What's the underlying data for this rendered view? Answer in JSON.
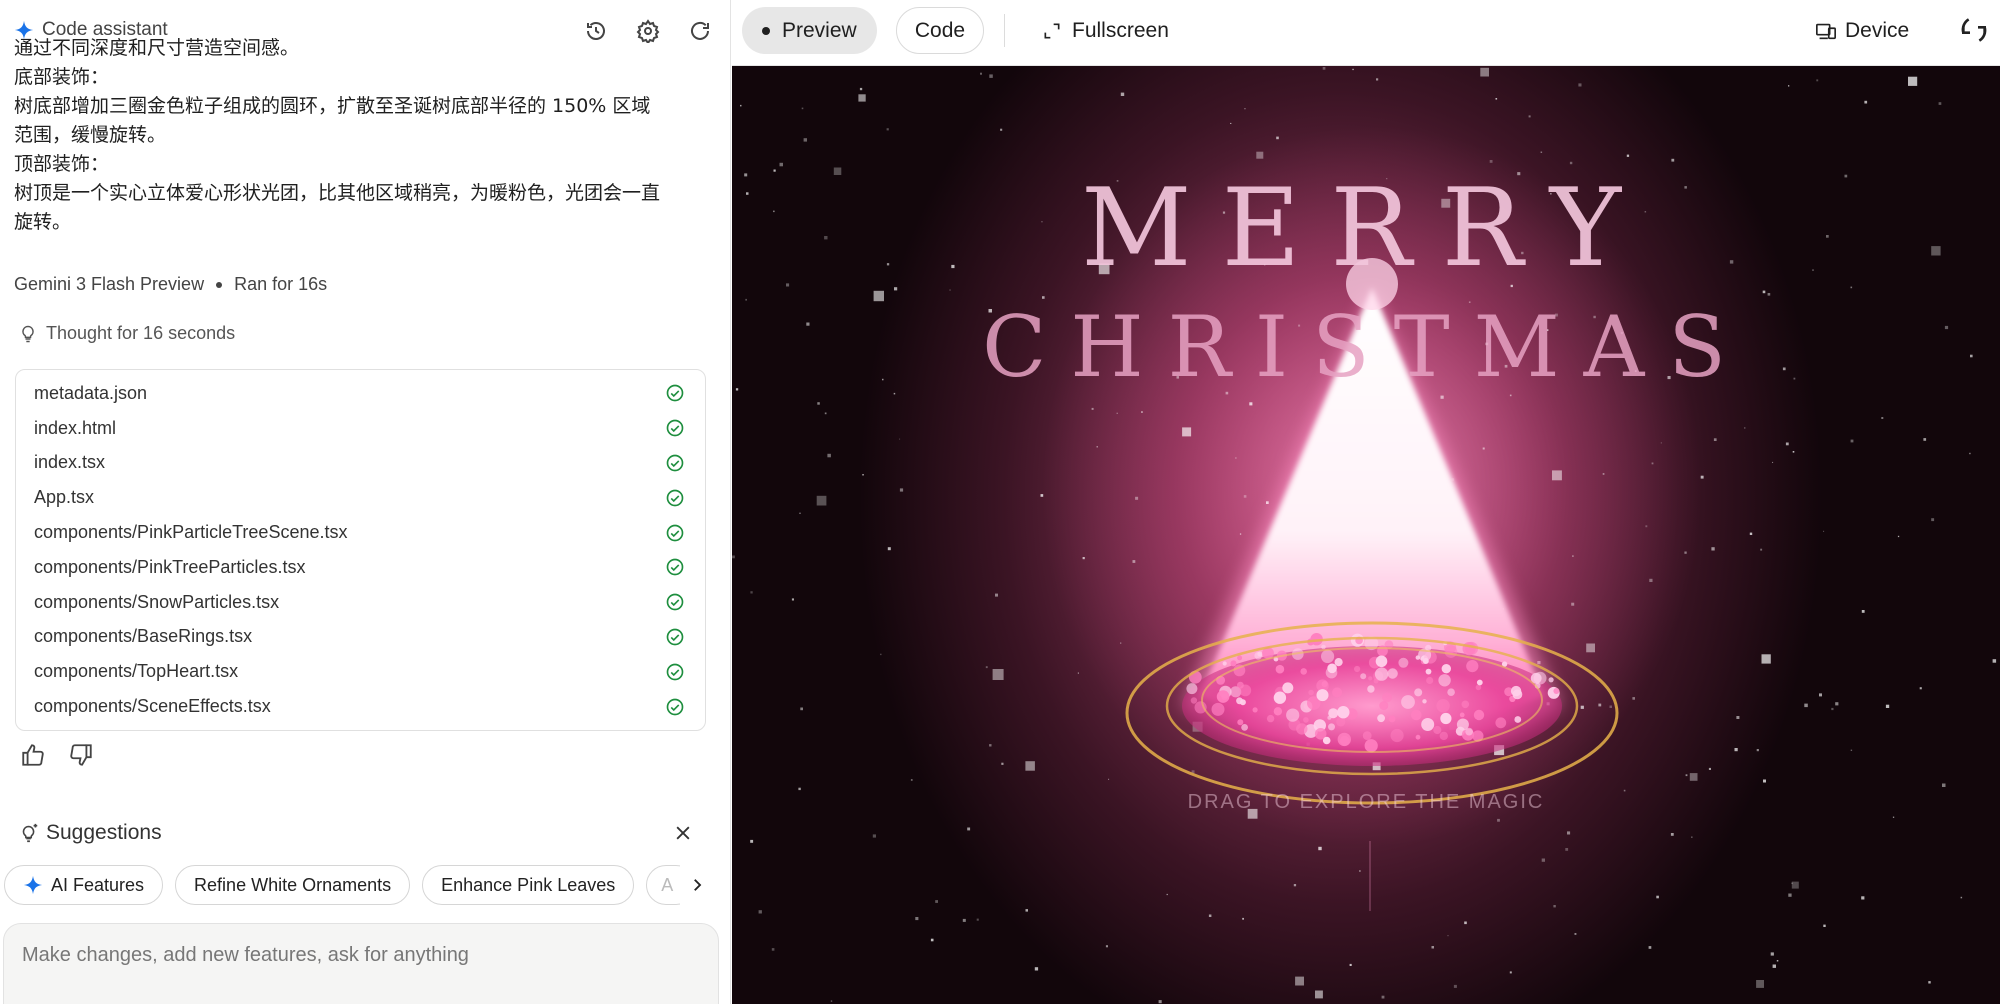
{
  "header": {
    "app_title": "Code assistant",
    "icons": [
      "history-icon",
      "gear-icon",
      "refresh-icon"
    ]
  },
  "chat": {
    "lines": [
      "通过不同深度和尺寸营造空间感。",
      "底部装饰：",
      "树底部增加三圈金色粒子组成的圆环，扩散至圣诞树底部半径的 150% 区域",
      "范围，缓慢旋转。",
      "顶部装饰：",
      "树顶是一个实心立体爱心形状光团，比其他区域稍亮，为暖粉色，光团会一直",
      "旋转。"
    ],
    "model": "Gemini 3 Flash Preview",
    "run_time": "Ran for 16s",
    "thought": "Thought for 16 seconds"
  },
  "files": [
    {
      "name": "metadata.json"
    },
    {
      "name": "index.html"
    },
    {
      "name": "index.tsx"
    },
    {
      "name": "App.tsx"
    },
    {
      "name": "components/PinkParticleTreeScene.tsx"
    },
    {
      "name": "components/PinkTreeParticles.tsx"
    },
    {
      "name": "components/SnowParticles.tsx"
    },
    {
      "name": "components/BaseRings.tsx"
    },
    {
      "name": "components/TopHeart.tsx"
    },
    {
      "name": "components/SceneEffects.tsx"
    }
  ],
  "suggestions": {
    "title": "Suggestions",
    "chips": [
      "AI Features",
      "Refine White Ornaments",
      "Enhance Pink Leaves",
      "A"
    ]
  },
  "input": {
    "placeholder": "Make changes, add new features, ask for anything"
  },
  "toolbar": {
    "preview_label": "Preview",
    "code_label": "Code",
    "fullscreen_label": "Fullscreen",
    "device_label": "Device"
  },
  "preview": {
    "title_line1": "MERRY",
    "title_line2": "CHRISTMAS",
    "hint": "DRAG TO EXPLORE THE MAGIC"
  },
  "colors": {
    "accent_blue": "#1a73e8",
    "check_green": "#1e8e3e",
    "tree_pink": "#ff6fae",
    "ring_gold": "#e0b040"
  }
}
